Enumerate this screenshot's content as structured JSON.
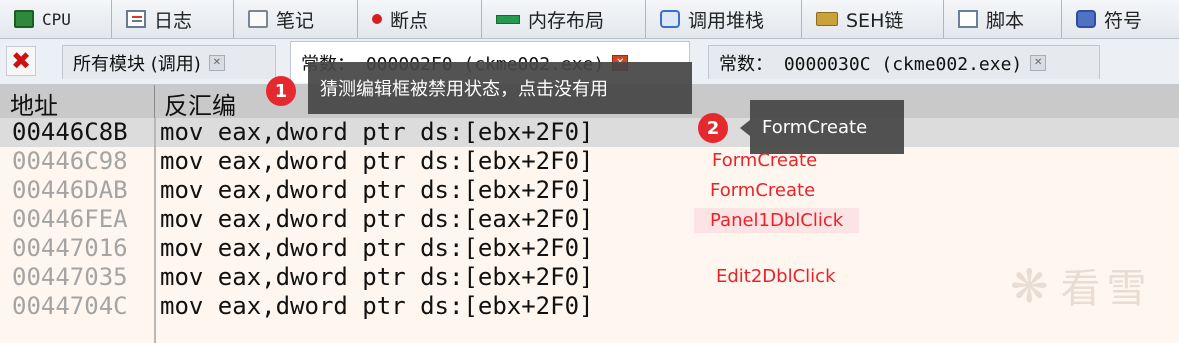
{
  "toolbar": {
    "items": [
      {
        "label": "CPU",
        "icon": "cpu-icon"
      },
      {
        "label": "日志",
        "icon": "log-icon"
      },
      {
        "label": "笔记",
        "icon": "notes-icon"
      },
      {
        "label": "断点",
        "icon": "breakpoint-icon"
      },
      {
        "label": "内存布局",
        "icon": "memory-map-icon"
      },
      {
        "label": "调用堆栈",
        "icon": "call-stack-icon"
      },
      {
        "label": "SEH链",
        "icon": "seh-icon"
      },
      {
        "label": "脚本",
        "icon": "script-icon"
      },
      {
        "label": "符号",
        "icon": "symbols-icon"
      }
    ]
  },
  "module_tabs": {
    "close_all": "✖",
    "tabs": [
      {
        "label": "所有模块 (调用)",
        "active": false
      },
      {
        "label": "常数： 000002F0 (ckme002.exe)",
        "active": true
      },
      {
        "label": "常数： 0000030C (ckme002.exe)",
        "active": false
      }
    ]
  },
  "columns": {
    "address": "地址",
    "disassembly": "反汇编"
  },
  "rows": [
    {
      "address": "00446C8B",
      "instruction": "mov eax,dword ptr ds:[ebx+2F0]",
      "selected": true
    },
    {
      "address": "00446C98",
      "instruction": "mov eax,dword ptr ds:[ebx+2F0]",
      "selected": false
    },
    {
      "address": "00446DAB",
      "instruction": "mov eax,dword ptr ds:[ebx+2F0]",
      "selected": false
    },
    {
      "address": "00446FEA",
      "instruction": "mov eax,dword ptr ds:[eax+2F0]",
      "selected": false
    },
    {
      "address": "00447016",
      "instruction": "mov eax,dword ptr ds:[ebx+2F0]",
      "selected": false
    },
    {
      "address": "00447035",
      "instruction": "mov eax,dword ptr ds:[ebx+2F0]",
      "selected": false
    },
    {
      "address": "0044704C",
      "instruction": "mov eax,dword ptr ds:[ebx+2F0]",
      "selected": false
    }
  ],
  "annotations": {
    "callout1": {
      "number": "1",
      "text": "猜测编辑框被禁用状态，点击没有用"
    },
    "callout2": {
      "number": "2",
      "text": "FormCreate"
    },
    "labels": [
      "FormCreate",
      "FormCreate",
      "Panel1DblClick",
      "Edit2DblClick"
    ]
  },
  "watermark": {
    "symbol": "❋",
    "text": "看雪"
  },
  "colors": {
    "accent_red": "#e6282f",
    "selected_row": "#dcdcdc",
    "header_bg": "#c9c9c9",
    "listing_bg": "#fff6ef"
  }
}
